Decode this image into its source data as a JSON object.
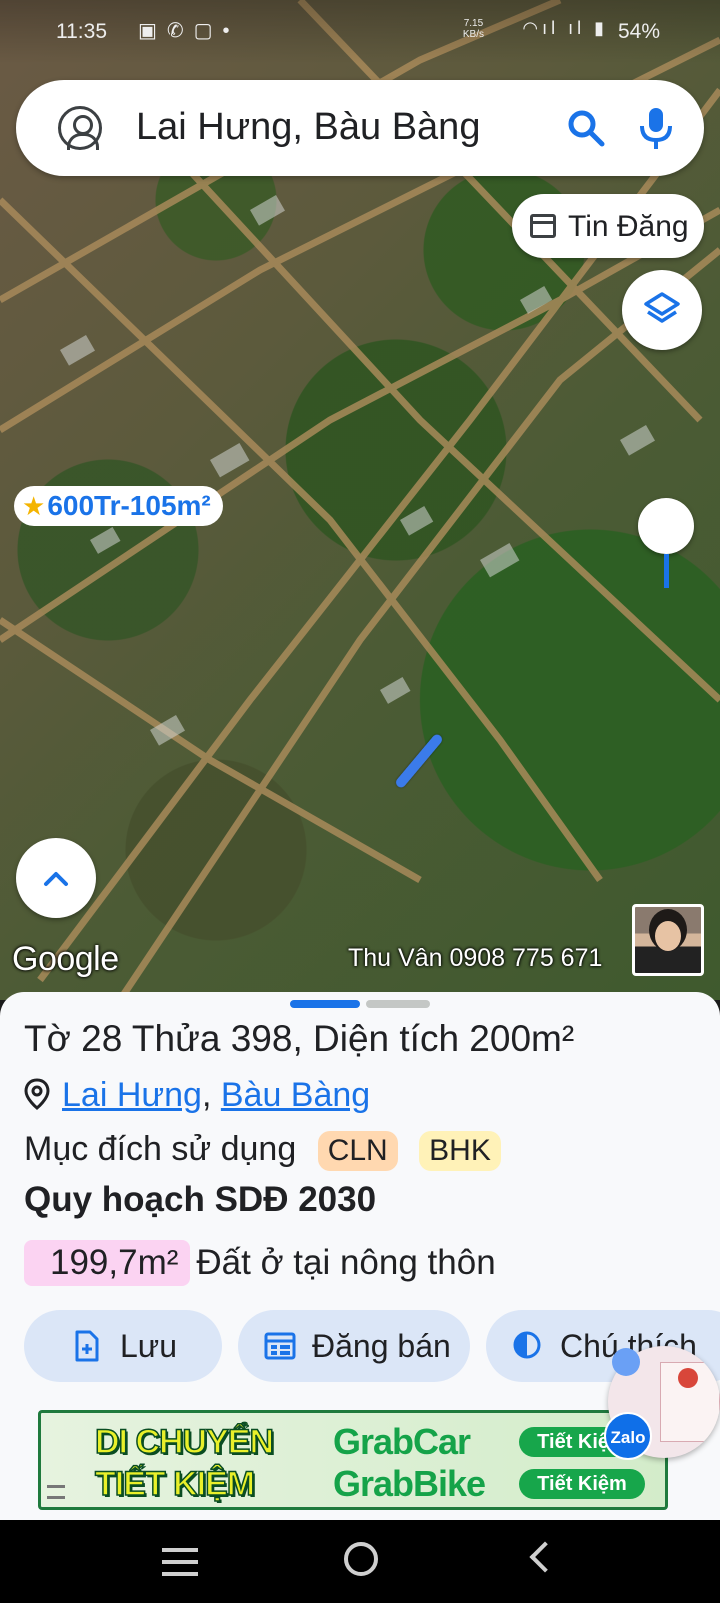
{
  "status_bar": {
    "time": "11:35",
    "net_speed": "7.15",
    "net_unit": "KB/s",
    "battery": "54%"
  },
  "search": {
    "query": "Lai Hưng, Bàu Bàng"
  },
  "map": {
    "listing_button_label": "Tin Đăng",
    "price_marker": "600Tr-105m²",
    "brand_logo": "Google",
    "contact_text": "Thu Vân 0908 775 671"
  },
  "sheet": {
    "title": "Tờ 28 Thửa 398, Diện tích 200m²",
    "location_parts": [
      "Lai Hưng",
      "Bàu Bàng"
    ],
    "location_separator": ",",
    "usage_label": "Mục đích sử dụng",
    "usage_tags": [
      "CLN",
      "BHK"
    ],
    "plan_title": "Quy hoạch SDĐ 2030",
    "plan_area": "199,7m²",
    "plan_area_type": "Đất ở tại nông thôn",
    "actions": {
      "save": "Lưu",
      "sell": "Đăng bán",
      "legend": "Chú thích"
    }
  },
  "ad": {
    "line1": "DI CHUYỂN",
    "line2": "TIẾT KIỆM",
    "grab_car": "GrabCar",
    "grab_bike": "GrabBike",
    "badge1": "Tiết Kiệm",
    "badge2": "Tiết Kiệm"
  },
  "zalo_label": "Zalo",
  "colors": {
    "accent": "#1a73e8",
    "tag_cln": "#ffd8b0",
    "tag_bhk": "#fff2b8",
    "area_chip": "#fbd3f2",
    "action_bg": "#dbe6f7"
  }
}
